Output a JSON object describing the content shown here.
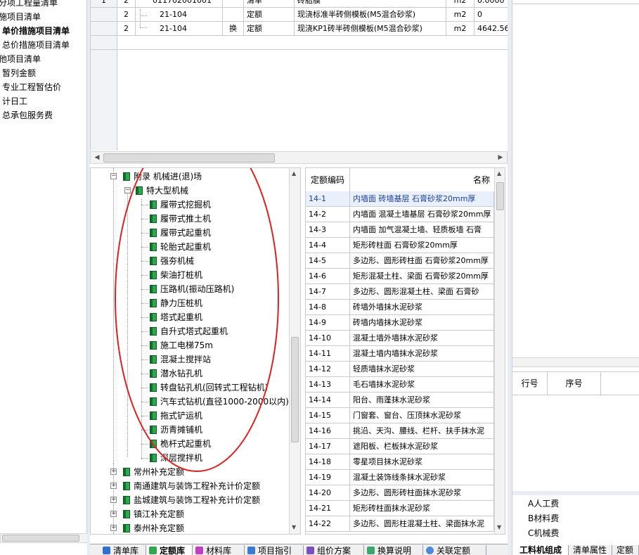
{
  "left_nav": {
    "items": [
      {
        "label": "分项工程量清单"
      },
      {
        "label": "施项目清单"
      },
      {
        "label": "单价措施项目清单"
      },
      {
        "label": "总价措施项目清单"
      },
      {
        "label": "他项目清单"
      },
      {
        "label": "暂列金额"
      },
      {
        "label": "专业工程暂估价"
      },
      {
        "label": "计日工"
      },
      {
        "label": "总承包服务费"
      }
    ]
  },
  "top_grid": {
    "rows": [
      {
        "num": "1",
        "level": "2",
        "code": "011702001001",
        "swap": "",
        "type": "清单",
        "name": "砖胎膜",
        "unit": "m2",
        "qty": "0.0000"
      },
      {
        "num": "",
        "level": "2",
        "code": "21-104",
        "swap": "",
        "type": "定额",
        "name": "现浇标准半砖侧模板(M5混合砂浆)",
        "unit": "m2",
        "qty": "0"
      },
      {
        "num": "",
        "level": "2",
        "code": "21-104",
        "swap": "换",
        "type": "定额",
        "name": "现浇KP1砖半砖侧模板(M5混合砂浆)",
        "unit": "m2",
        "qty": "4642.56"
      }
    ]
  },
  "tree": {
    "root_label": "附录 机械进(退)场",
    "group_label": "特大型机械",
    "leaves": [
      "履带式挖掘机",
      "履带式推土机",
      "履带式起重机",
      "轮胎式起重机",
      "强夯机械",
      "柴油打桩机",
      "压路机(振动压路机)",
      "静力压桩机",
      "塔式起重机",
      "自升式塔式起重机",
      "施工电梯75m",
      "混凝土搅拌站",
      "潜水钻孔机",
      "转盘钻孔机(回转式工程钻机)",
      "汽车式钻机(直径1000-2000以内)",
      "拖式铲运机",
      "沥青摊铺机",
      "桅杆式起重机",
      "深层搅拌机"
    ],
    "collapsed": [
      "常州补充定额",
      "南通建筑与装饰工程补充计价定额",
      "盐城建筑与装饰工程补充计价定额",
      "镇江补充定额",
      "泰州补充定额"
    ]
  },
  "code_table": {
    "headers": {
      "code": "定额编码",
      "name": "名称"
    },
    "rows": [
      {
        "code": "14-1",
        "name": "内墙面 砖墙基层 石膏砂浆20mm厚"
      },
      {
        "code": "14-2",
        "name": "内墙面 混凝土墙基层 石膏砂浆20mm厚"
      },
      {
        "code": "14-3",
        "name": "内墙面 加气混凝土墙、轻质板墙 石膏"
      },
      {
        "code": "14-4",
        "name": "矩形砖柱面  石膏砂浆20mm厚"
      },
      {
        "code": "14-5",
        "name": "多边形、圆形砖柱面 石膏砂浆20mm厚"
      },
      {
        "code": "14-6",
        "name": "矩形混凝土柱、梁面 石膏砂浆20mm厚"
      },
      {
        "code": "14-7",
        "name": "多边形、圆形混凝土柱、梁面 石膏砂"
      },
      {
        "code": "14-8",
        "name": "砖墙外墙抹水泥砂浆"
      },
      {
        "code": "14-9",
        "name": "砖墙内墙抹水泥砂浆"
      },
      {
        "code": "14-10",
        "name": "混凝土墙外墙抹水泥砂浆"
      },
      {
        "code": "14-11",
        "name": "混凝土墙内墙抹水泥砂浆"
      },
      {
        "code": "14-12",
        "name": "轻质墙抹水泥砂浆"
      },
      {
        "code": "14-13",
        "name": "毛石墙抹水泥砂浆"
      },
      {
        "code": "14-14",
        "name": "阳台、雨蓬抹水泥砂浆"
      },
      {
        "code": "14-15",
        "name": "门窗套、窗台、压顶抹水泥砂浆"
      },
      {
        "code": "14-16",
        "name": "挑沿、天沟、腰线、栏杆、扶手抹水泥"
      },
      {
        "code": "14-17",
        "name": "遮阳板、栏板抹水泥砂浆"
      },
      {
        "code": "14-18",
        "name": "零星项目抹水泥砂浆"
      },
      {
        "code": "14-19",
        "name": "混凝土装饰线条抹水泥砂浆"
      },
      {
        "code": "14-20",
        "name": "多边形、圆形砖柱面抹水泥砂浆"
      },
      {
        "code": "14-21",
        "name": "矩形砖柱面抹水泥砂浆"
      },
      {
        "code": "14-22",
        "name": "多边形、圆形柱混凝土柱、梁面抹水泥"
      }
    ]
  },
  "right_panel": {
    "grid_headers": [
      "行号",
      "序号"
    ],
    "cost_items": [
      "A人工费",
      "B材料费",
      "C机械费"
    ]
  },
  "bottom_tabs": [
    "清单库",
    "定额库",
    "材料库",
    "项目指引",
    "组价方案",
    "换算说明",
    "关联定额"
  ],
  "right_tabs": [
    "工料机组成",
    "清单属性",
    "定额"
  ],
  "colors": {
    "accent": "#1a3f9e",
    "tree_icon": "#2ea84a",
    "annotation": "#e02020"
  }
}
